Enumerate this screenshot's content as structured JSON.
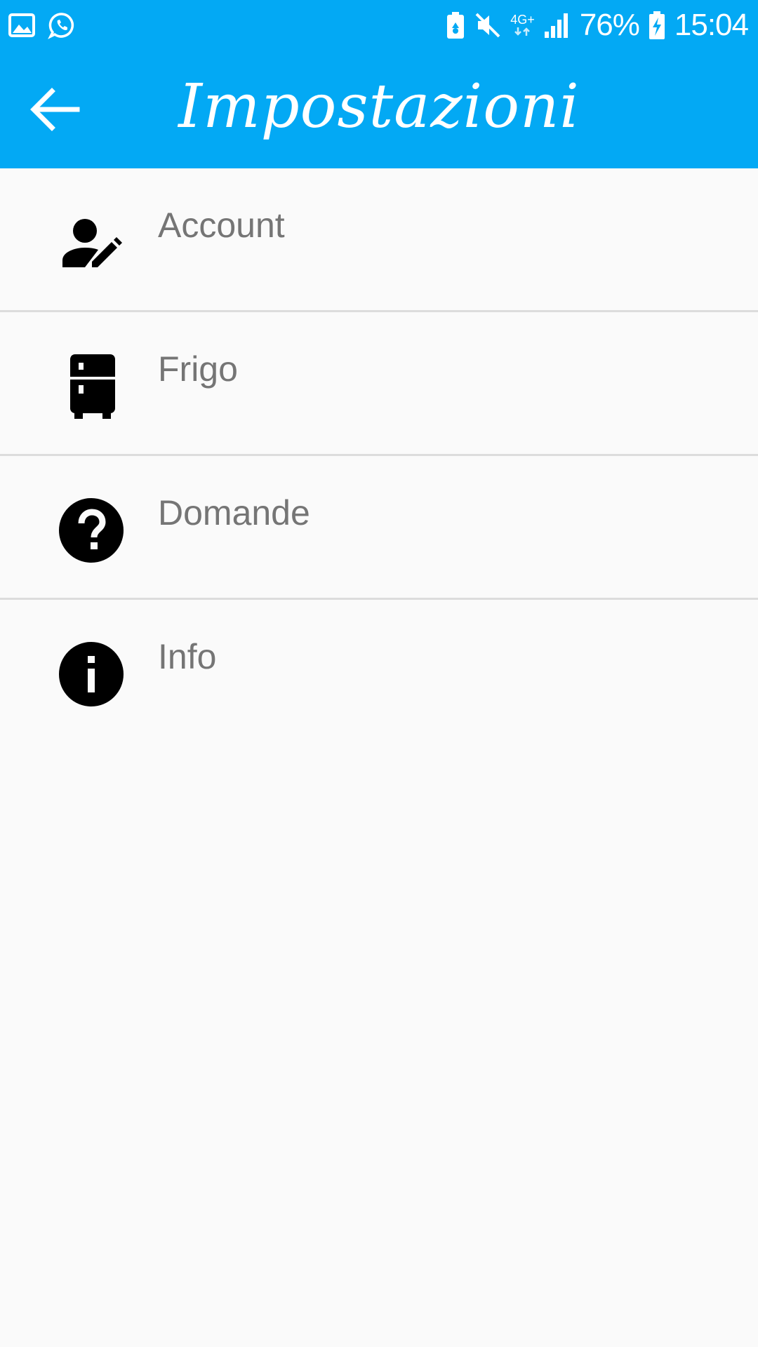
{
  "status_bar": {
    "left_icons": [
      "gallery-icon",
      "whatsapp-icon"
    ],
    "right_icons": [
      "battery-saver-icon",
      "mute-icon",
      "network-4g-icon",
      "signal-icon",
      "battery-charging-icon"
    ],
    "network_label": "4G+",
    "battery_percent": "76%",
    "time": "15:04"
  },
  "app_bar": {
    "back_icon": "arrow-back-icon",
    "title": "Impostazioni",
    "background_color": "#03a9f4"
  },
  "settings": {
    "items": [
      {
        "label": "Account",
        "icon": "account-edit-icon"
      },
      {
        "label": "Frigo",
        "icon": "fridge-icon"
      },
      {
        "label": "Domande",
        "icon": "help-icon"
      },
      {
        "label": "Info",
        "icon": "info-icon"
      }
    ]
  },
  "colors": {
    "primary": "#03a9f4",
    "label_text": "#757575",
    "divider": "#dcdcdc",
    "background": "#fafafa"
  }
}
